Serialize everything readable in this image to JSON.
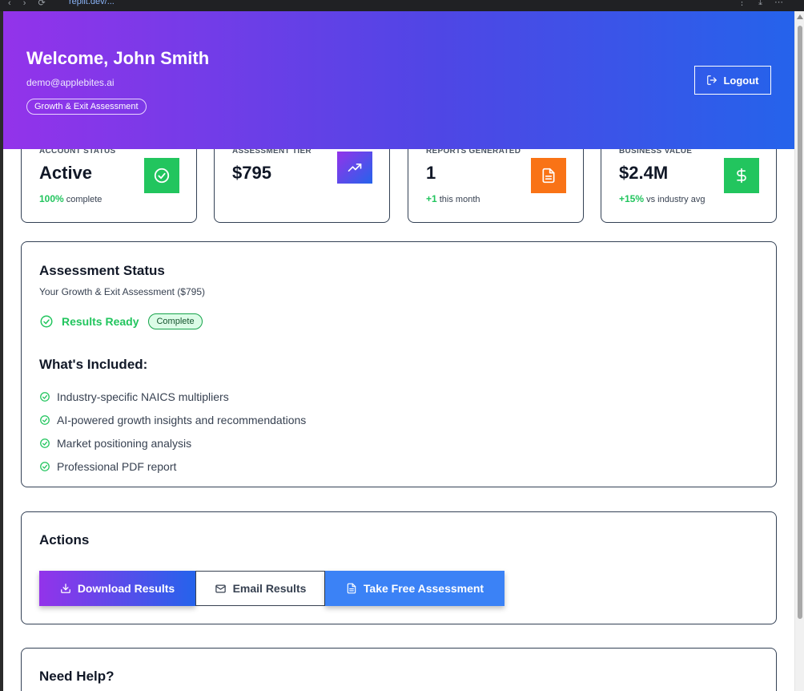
{
  "browser": {
    "url": "replit.dev/..."
  },
  "header": {
    "welcome": "Welcome, John Smith",
    "email": "demo@applebites.ai",
    "tier_badge": "Growth & Exit Assessment",
    "logout_label": "Logout"
  },
  "stats": [
    {
      "label": "ACCOUNT STATUS",
      "value": "Active",
      "delta": "100%",
      "sub": "complete",
      "icon": "check-circle-icon",
      "color": "#22c55e"
    },
    {
      "label": "ASSESSMENT TIER",
      "value": "$795",
      "delta": "",
      "sub": "",
      "icon": "trending-up-icon",
      "color": "#6d28d9"
    },
    {
      "label": "REPORTS GENERATED",
      "value": "1",
      "delta": "+1",
      "sub": "this month",
      "icon": "document-icon",
      "color": "#f97316"
    },
    {
      "label": "BUSINESS VALUE",
      "value": "$2.4M",
      "delta": "+15%",
      "sub": "vs industry avg",
      "icon": "dollar-icon",
      "color": "#22c55e"
    }
  ],
  "assessment": {
    "title": "Assessment Status",
    "subtitle": "Your Growth & Exit Assessment ($795)",
    "status_label": "Results Ready",
    "status_badge": "Complete",
    "included_title": "What's Included:",
    "features": [
      "Industry-specific NAICS multipliers",
      "AI-powered growth insights and recommendations",
      "Market positioning analysis",
      "Professional PDF report"
    ]
  },
  "actions": {
    "title": "Actions",
    "download_label": "Download Results",
    "email_label": "Email Results",
    "free_label": "Take Free Assessment"
  },
  "help": {
    "title": "Need Help?"
  },
  "colors": {
    "accent_purple": "#9333ea",
    "accent_blue": "#2563eb",
    "success": "#22c55e",
    "orange": "#f97316"
  }
}
